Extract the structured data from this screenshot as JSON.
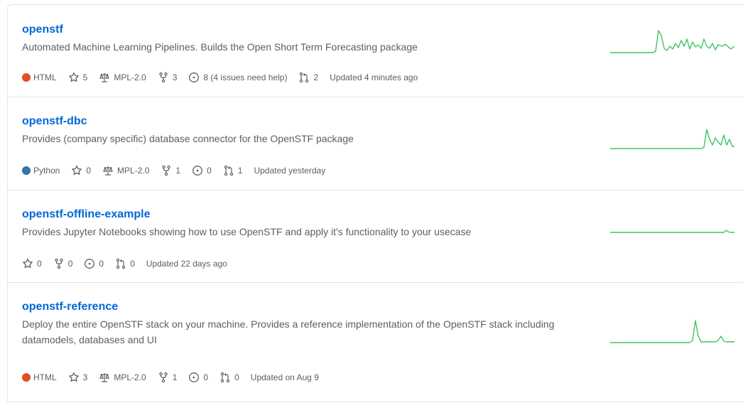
{
  "colors": {
    "link": "#0366d6",
    "muted": "#586069",
    "spark": "#40c463",
    "html": "#e34c26",
    "python": "#3572A5"
  },
  "repos": [
    {
      "name": "openstf",
      "description": "Automated Machine Learning Pipelines. Builds the Open Short Term Forecasting package",
      "language": "HTML",
      "language_color": "#e34c26",
      "stars": "5",
      "license": "MPL-2.0",
      "forks": "3",
      "issues": "8 (4 issues need help)",
      "pulls": "2",
      "updated": "Updated 4 minutes ago"
    },
    {
      "name": "openstf-dbc",
      "description": "Provides (company specific) database connector for the OpenSTF package",
      "language": "Python",
      "language_color": "#3572A5",
      "stars": "0",
      "license": "MPL-2.0",
      "forks": "1",
      "issues": "0",
      "pulls": "1",
      "updated": "Updated yesterday"
    },
    {
      "name": "openstf-offline-example",
      "description": "Provides Jupyter Notebooks showing how to use OpenSTF and apply it's functionality to your usecase",
      "stars": "0",
      "forks": "0",
      "issues": "0",
      "pulls": "0",
      "updated": "Updated 22 days ago"
    },
    {
      "name": "openstf-reference",
      "description": "Deploy the entire OpenSTF stack on your machine. Provides a reference implementation of the OpenSTF stack including datamodels, databases and UI",
      "language": "HTML",
      "language_color": "#e34c26",
      "stars": "3",
      "license": "MPL-2.0",
      "forks": "1",
      "issues": "0",
      "pulls": "0",
      "updated": "Updated on Aug 9"
    }
  ]
}
